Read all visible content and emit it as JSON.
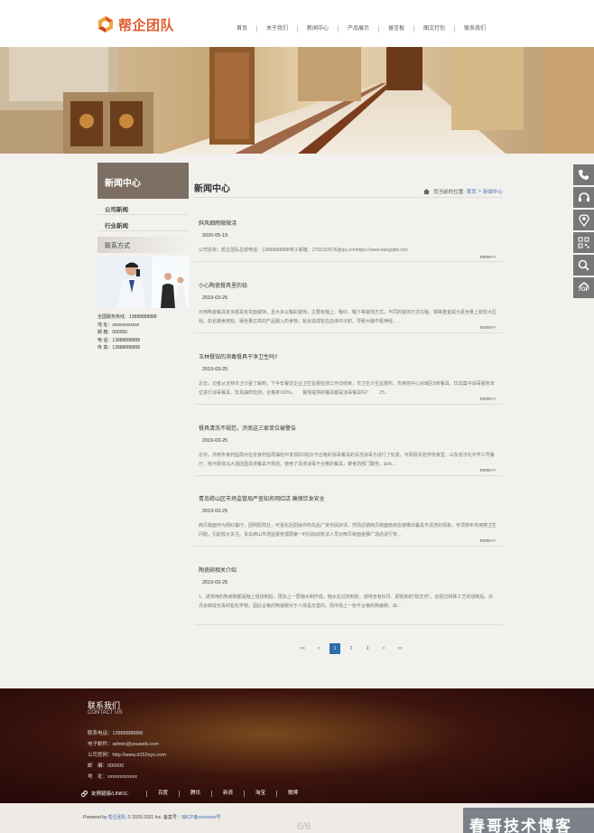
{
  "header": {
    "logo_text": "帮企团队",
    "nav": [
      "首页",
      "关于我们",
      "新闻中心",
      "产品展示",
      "留言板",
      "图文打包",
      "联系我们"
    ]
  },
  "sidebar": {
    "title": "新闻中心",
    "items": [
      "公司新闻",
      "行业新闻"
    ],
    "contact_title": "联系方式",
    "contact_lines": [
      "全国服务热线：13888888888",
      "地 址：xxxxxxxxxxxx",
      "邮 箱：000000",
      "电 话：13888888888",
      "传 真：13888888888"
    ]
  },
  "main": {
    "title": "新闻中心",
    "crumb_label": "您当前的位置:",
    "crumb_home": "首页",
    "crumb_sep": ">",
    "crumb_current": "新闻中心",
    "more_label": "more>>",
    "articles": [
      {
        "title": "斜风细雨微微浇",
        "date": "2020-05-19",
        "summary": "公司名称：帮企团队总部电话：13888888888电子邮箱：2759152676@qq.comhttps://www.bangqitd.com"
      },
      {
        "title": "小心陶瓷餐具里的铅",
        "date": "2019-03-25",
        "summary": "日用陶瓷餐具有多都具有花面装饰，且大多以釉彩装饰，主要有釉上、釉中、釉下等装饰方式，不同的装饰方式在釉、铜等重金属元素含量上有较大区别。如长期食用铅、镉含量过高的产品摄入的食物，就会造成铅在血液中沉积，导致大脑中枢神经、..."
      },
      {
        "title": "玉林餐馆的消毒餐具干净卫生吗?",
        "date": "2019-03-25",
        "summary": "近日，记者从玉林市卫计委了解到，下半年餐饮企业卫生监督检测工作日结束，市卫生计生监督所、市疾控中心对城区8家餐具、饮具集中消毒服务单位进行消毒餐具、饮具抽样检测，合格率100%。　　餐馆提供的餐具都是消毒餐具吗？　　25..."
      },
      {
        "title": "餐具清洗不规范，济南这三家单位被警告",
        "date": "2019-03-25",
        "summary": "近日，济南市食药监局对在省食药监局抽检中发现的3批次不合格的消毒餐具的清洗消毒方进行了处置。平阴县实验学校食堂、山东省济北中学三号餐厅、南河县铁马大酒店因清洗餐具不规范，使用了清洗消毒不合格的餐具，被食药部门警告。&nb..."
      },
      {
        "title": "青岛崂山区市场监管局严查知名网红店 确保饮食安全",
        "date": "2019-03-25",
        "summary": "西贝莜面作为网红餐厅，因明厨亮灶，可视化后厨操作的先后广受市民好评。然而近期西贝莜面南京店被曝出餐具不清洗的现象，专项抹布专用擦卫生问题，引起较大关注。青岛崂山市场监督管理局第一时间启动执法人员对西贝莜面金狮广场店进行突..."
      },
      {
        "title": "陶瓷碗相关介绍",
        "date": "2019-03-25",
        "summary": "1、通常用的陶瓷碗都是釉上经烧制后，再加上一层釉水制作成。釉水在过烧制前，通常含有红丹、即铅和的\"稳定剂\"。在经过特殊工艺的烧制后，红丹会转成无毒的铅化学物，因此合格的陶瓷碗对于人体是无害的。而市场上一些不合格的陶瓷碗，由..."
      }
    ]
  },
  "pager": [
    "<<",
    "<",
    "1",
    "2",
    "3",
    ">",
    ">>"
  ],
  "pager_active": "1",
  "footer": {
    "title": "联系我们",
    "subtitle": "CONTACT US",
    "info": [
      "联系电话：13888888888",
      "电子邮件：admin@youweb.com",
      "公司官网：http://www.d152xys.com",
      "邮　编：000000",
      "地　址：xxxxxxxxxxxx"
    ],
    "links_label": "友情链接/LINKS：",
    "links": [
      "百度",
      "腾讯",
      "新浪",
      "淘宝",
      "微博"
    ]
  },
  "copyright": {
    "prefix": "Powered by ",
    "brand": "帮企团队",
    "mid": " © 2020-2021 Inc. 备案号：",
    "icp": "琼ICP备xxxxxxxx号"
  },
  "page_indicator": "6/6",
  "watermark": "春哥技术博客",
  "colors": {
    "accent_orange": "#e05a2a",
    "sidebar_title_bg": "#7d6f63",
    "pager_active": "#2d6da8",
    "footer_bg": "#3c140e"
  },
  "float_icons": [
    "phone-icon",
    "headset-icon",
    "location-icon",
    "qrcode-icon",
    "search-icon",
    "back-to-top-icon"
  ],
  "float_top_label": "TOP"
}
